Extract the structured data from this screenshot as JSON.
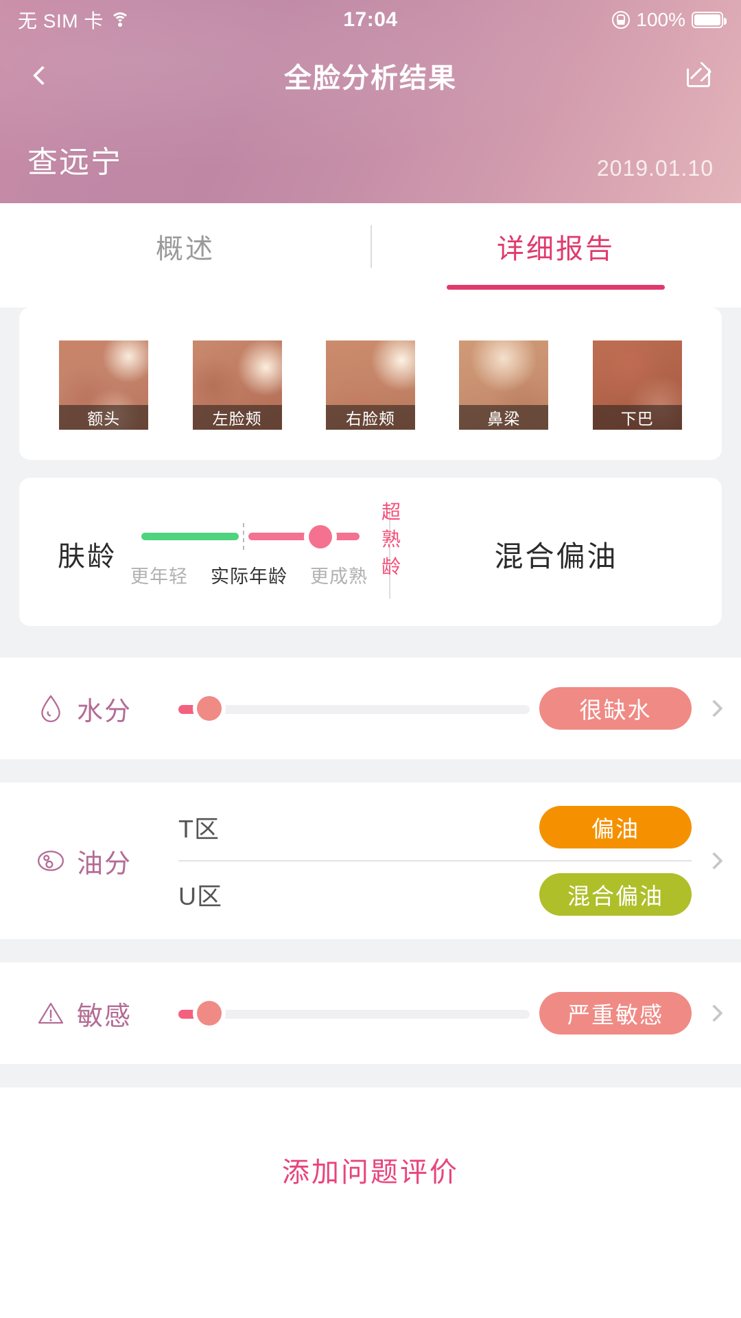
{
  "status_bar": {
    "carrier": "无 SIM 卡",
    "time": "17:04",
    "battery_percent": "100%",
    "wifi_icon": "wifi-icon",
    "lock_icon": "rotation-lock-icon",
    "battery_icon": "battery-full-icon"
  },
  "nav": {
    "back_icon": "chevron-left-icon",
    "title": "全脸分析结果",
    "share_icon": "share-icon"
  },
  "subheader": {
    "user_name": "查远宁",
    "date": "2019.01.10"
  },
  "tabs": [
    {
      "label": "概述",
      "active": false
    },
    {
      "label": "详细报告",
      "active": true
    }
  ],
  "skin_patches": {
    "items": [
      {
        "label": "额头"
      },
      {
        "label": "左脸颊"
      },
      {
        "label": "右脸颊"
      },
      {
        "label": "鼻梁"
      },
      {
        "label": "下巴"
      }
    ]
  },
  "skin_age": {
    "label": "肤龄",
    "badge": "超熟龄",
    "scale": [
      "更年轻",
      "实际年龄",
      "更成熟"
    ],
    "green_color": "#4fd37f",
    "pink_color": "#f4718f",
    "summary": "混合偏油"
  },
  "metrics": [
    {
      "icon": "water-drop-icon",
      "name": "水分",
      "slider_value": 7,
      "result": "很缺水",
      "result_color": "#f08a85",
      "chevron_icon": "chevron-right-icon"
    },
    {
      "icon": "oil-pores-icon",
      "name": "油分",
      "zones": [
        {
          "zone": "T区",
          "result": "偏油",
          "result_color": "#f59100"
        },
        {
          "zone": "U区",
          "result": "混合偏油",
          "result_color": "#aebf29"
        }
      ],
      "chevron_icon": "chevron-right-icon"
    },
    {
      "icon": "warning-triangle-icon",
      "name": "敏感",
      "slider_value": 7,
      "result": "严重敏感",
      "result_color": "#f08a85",
      "chevron_icon": "chevron-right-icon"
    }
  ],
  "footer": {
    "add_review_label": "添加问题评价",
    "accent_color": "#e8447d"
  }
}
